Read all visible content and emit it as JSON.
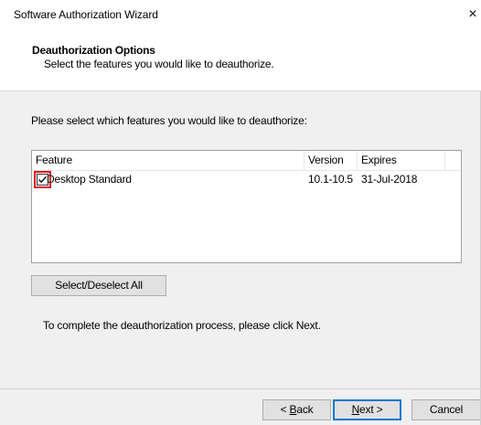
{
  "window": {
    "title": "Software Authorization Wizard",
    "close_glyph": "×"
  },
  "header": {
    "title": "Deauthorization Options",
    "subtitle": "Select the features you would like to deauthorize."
  },
  "instruction": "Please select which features you would like to deauthorize:",
  "list": {
    "columns": [
      "Feature",
      "Version",
      "Expires"
    ],
    "rows": [
      {
        "feature": "Desktop Standard",
        "version": "10.1-10.5",
        "expires": "31-Jul-2018",
        "checked": true
      }
    ]
  },
  "buttons": {
    "select_all": "Select/Deselect All",
    "back_mnemonic": "B",
    "back_rest": "ack",
    "back_prefix": "< ",
    "next_mnemonic": "N",
    "next_rest": "ext >",
    "cancel": "Cancel"
  },
  "complete_text": "To complete the deauthorization process, please click Next.",
  "colors": {
    "window_bg": "#f0f0f0",
    "highlight": "#e0141e",
    "default_button_border": "#0078d7"
  },
  "icons": {
    "close": "close-icon",
    "checkbox": "checkbox-checked-icon"
  }
}
